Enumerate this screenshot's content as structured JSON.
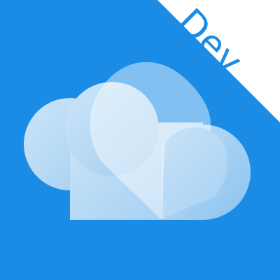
{
  "app_icon": {
    "icon_name": "cloud-heart-icon",
    "badge": {
      "label": "Dev"
    }
  },
  "colors": {
    "background": "#1a8ce6",
    "badge_fill": "#ffffff",
    "badge_text": "#1a8ce6",
    "cloud_light": "#e3f0fb",
    "cloud_mid": "#c3ddf5",
    "heart_fill": "#f2f8ff"
  }
}
